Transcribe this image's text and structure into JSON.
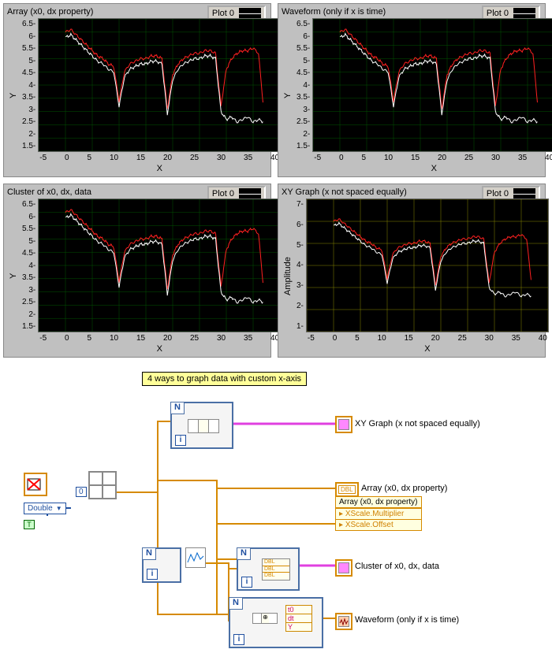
{
  "panels": [
    {
      "title": "Array (x0, dx property)",
      "legend": "Plot 0",
      "ylabel": "Y",
      "xlabel": "X",
      "grid": "green"
    },
    {
      "title": "Waveform (only if x is time)",
      "legend": "Plot 0",
      "ylabel": "Y",
      "xlabel": "X",
      "grid": "green"
    },
    {
      "title": "Cluster of x0, dx, data",
      "legend": "Plot 0",
      "ylabel": "Y",
      "xlabel": "X",
      "grid": "green"
    },
    {
      "title": "XY Graph (x not spaced equally)",
      "legend": "Plot 0",
      "ylabel": "Amplitude",
      "xlabel": "X",
      "grid": "yellow"
    }
  ],
  "chart_data": [
    {
      "type": "line",
      "title": "Array (x0, dx property)",
      "xlabel": "X",
      "ylabel": "Y",
      "xlim": [
        -5,
        40
      ],
      "ylim": [
        1.5,
        6.5
      ],
      "xticks": [
        -5,
        0,
        5,
        10,
        15,
        20,
        25,
        30,
        35,
        40
      ],
      "yticks": [
        1.5,
        2,
        2.5,
        3,
        3.5,
        4,
        4.5,
        5,
        5.5,
        6,
        6.5
      ],
      "grid_color": "#005500",
      "series": [
        {
          "name": "red",
          "x": [
            0,
            1,
            2,
            3,
            4,
            5,
            6,
            7,
            8,
            9,
            10,
            11,
            12,
            13,
            14,
            15,
            16,
            17,
            18,
            19,
            20,
            21,
            22,
            23,
            24,
            25,
            26,
            27,
            28,
            29,
            30,
            31,
            32,
            33,
            34,
            35,
            36,
            37
          ],
          "values": [
            6.0,
            6.1,
            5.9,
            5.7,
            5.5,
            5.3,
            5.1,
            5.0,
            4.8,
            4.7,
            3.4,
            4.5,
            4.8,
            4.9,
            5.0,
            5.0,
            5.1,
            5.1,
            5.0,
            3.1,
            4.4,
            4.8,
            5.0,
            5.1,
            5.2,
            5.2,
            5.3,
            5.3,
            5.2,
            3.2,
            4.6,
            5.0,
            5.2,
            5.3,
            5.3,
            5.4,
            5.2,
            3.0
          ]
        },
        {
          "name": "white",
          "x": [
            0,
            1,
            2,
            3,
            4,
            5,
            6,
            7,
            8,
            9,
            10,
            11,
            12,
            13,
            14,
            15,
            16,
            17,
            18,
            19,
            20,
            21,
            22,
            23,
            24,
            25,
            26,
            27,
            28,
            29,
            30,
            31,
            32,
            33,
            34,
            35,
            36,
            37
          ],
          "values": [
            5.8,
            5.9,
            5.7,
            5.5,
            5.3,
            5.1,
            4.9,
            4.8,
            4.6,
            4.5,
            3.2,
            4.3,
            4.6,
            4.7,
            4.8,
            4.8,
            4.9,
            4.9,
            4.8,
            2.9,
            4.2,
            4.6,
            4.8,
            4.9,
            5.0,
            5.0,
            5.1,
            5.1,
            5.0,
            3.0,
            2.7,
            2.8,
            2.6,
            2.7,
            2.8,
            2.6,
            2.7,
            2.6
          ]
        }
      ]
    },
    {
      "type": "line",
      "title": "Waveform (only if x is time)",
      "xlabel": "X",
      "ylabel": "Y",
      "xlim": [
        -5,
        40
      ],
      "ylim": [
        1.5,
        6.5
      ],
      "xticks": [
        -5,
        0,
        5,
        10,
        15,
        20,
        25,
        30,
        35,
        40
      ],
      "yticks": [
        1.5,
        2,
        2.5,
        3,
        3.5,
        4,
        4.5,
        5,
        5.5,
        6,
        6.5
      ],
      "grid_color": "#005500",
      "series": [
        {
          "name": "red",
          "x": [
            0,
            1,
            2,
            3,
            4,
            5,
            6,
            7,
            8,
            9,
            10,
            11,
            12,
            13,
            14,
            15,
            16,
            17,
            18,
            19,
            20,
            21,
            22,
            23,
            24,
            25,
            26,
            27,
            28,
            29,
            30,
            31,
            32,
            33,
            34,
            35,
            36,
            37
          ],
          "values": [
            6.0,
            6.1,
            5.9,
            5.7,
            5.5,
            5.3,
            5.1,
            5.0,
            4.8,
            4.7,
            3.4,
            4.5,
            4.8,
            4.9,
            5.0,
            5.0,
            5.1,
            5.1,
            5.0,
            3.1,
            4.4,
            4.8,
            5.0,
            5.1,
            5.2,
            5.2,
            5.3,
            5.3,
            5.2,
            3.2,
            4.6,
            5.0,
            5.2,
            5.3,
            5.3,
            5.4,
            5.2,
            3.0
          ]
        },
        {
          "name": "white",
          "x": [
            0,
            1,
            2,
            3,
            4,
            5,
            6,
            7,
            8,
            9,
            10,
            11,
            12,
            13,
            14,
            15,
            16,
            17,
            18,
            19,
            20,
            21,
            22,
            23,
            24,
            25,
            26,
            27,
            28,
            29,
            30,
            31,
            32,
            33,
            34,
            35,
            36,
            37
          ],
          "values": [
            5.8,
            5.9,
            5.7,
            5.5,
            5.3,
            5.1,
            4.9,
            4.8,
            4.6,
            4.5,
            3.2,
            4.3,
            4.6,
            4.7,
            4.8,
            4.8,
            4.9,
            4.9,
            4.8,
            2.9,
            4.2,
            4.6,
            4.8,
            4.9,
            5.0,
            5.0,
            5.1,
            5.1,
            5.0,
            3.0,
            2.7,
            2.8,
            2.6,
            2.7,
            2.8,
            2.6,
            2.7,
            2.6
          ]
        }
      ]
    },
    {
      "type": "line",
      "title": "Cluster of x0, dx, data",
      "xlabel": "X",
      "ylabel": "Y",
      "xlim": [
        -5,
        40
      ],
      "ylim": [
        1.5,
        6.5
      ],
      "xticks": [
        -5,
        0,
        5,
        10,
        15,
        20,
        25,
        30,
        35,
        40
      ],
      "yticks": [
        1.5,
        2,
        2.5,
        3,
        3.5,
        4,
        4.5,
        5,
        5.5,
        6,
        6.5
      ],
      "grid_color": "#005500",
      "series": [
        {
          "name": "red",
          "x": [
            0,
            1,
            2,
            3,
            4,
            5,
            6,
            7,
            8,
            9,
            10,
            11,
            12,
            13,
            14,
            15,
            16,
            17,
            18,
            19,
            20,
            21,
            22,
            23,
            24,
            25,
            26,
            27,
            28,
            29,
            30,
            31,
            32,
            33,
            34,
            35,
            36,
            37
          ],
          "values": [
            6.0,
            6.1,
            5.9,
            5.7,
            5.5,
            5.3,
            5.1,
            5.0,
            4.8,
            4.7,
            3.4,
            4.5,
            4.8,
            4.9,
            5.0,
            5.0,
            5.1,
            5.1,
            5.0,
            3.1,
            4.4,
            4.8,
            5.0,
            5.1,
            5.2,
            5.2,
            5.3,
            5.3,
            5.2,
            3.2,
            4.6,
            5.0,
            5.2,
            5.3,
            5.3,
            5.4,
            5.2,
            3.0
          ]
        },
        {
          "name": "white",
          "x": [
            0,
            1,
            2,
            3,
            4,
            5,
            6,
            7,
            8,
            9,
            10,
            11,
            12,
            13,
            14,
            15,
            16,
            17,
            18,
            19,
            20,
            21,
            22,
            23,
            24,
            25,
            26,
            27,
            28,
            29,
            30,
            31,
            32,
            33,
            34,
            35,
            36,
            37
          ],
          "values": [
            5.8,
            5.9,
            5.7,
            5.5,
            5.3,
            5.1,
            4.9,
            4.8,
            4.6,
            4.5,
            3.2,
            4.3,
            4.6,
            4.7,
            4.8,
            4.8,
            4.9,
            4.9,
            4.8,
            2.9,
            4.2,
            4.6,
            4.8,
            4.9,
            5.0,
            5.0,
            5.1,
            5.1,
            5.0,
            3.0,
            2.7,
            2.8,
            2.6,
            2.7,
            2.8,
            2.6,
            2.7,
            2.6
          ]
        }
      ]
    },
    {
      "type": "line",
      "title": "XY Graph (x not spaced equally)",
      "xlabel": "X",
      "ylabel": "Amplitude",
      "xlim": [
        -5,
        40
      ],
      "ylim": [
        1,
        7
      ],
      "xticks": [
        -5,
        0,
        5,
        10,
        15,
        20,
        25,
        30,
        35,
        40
      ],
      "yticks": [
        1,
        2,
        3,
        4,
        5,
        6,
        7
      ],
      "grid_color": "#888800",
      "series": [
        {
          "name": "red",
          "x": [
            0,
            1,
            2,
            3,
            4,
            5,
            6,
            7,
            8,
            9,
            10,
            11,
            12,
            13,
            14,
            15,
            16,
            17,
            18,
            19,
            20,
            21,
            22,
            23,
            24,
            25,
            26,
            27,
            28,
            29,
            30,
            31,
            32,
            33,
            34,
            35,
            36,
            37
          ],
          "values": [
            6.0,
            6.1,
            5.9,
            5.7,
            5.5,
            5.3,
            5.1,
            5.0,
            4.8,
            4.7,
            3.4,
            4.5,
            4.8,
            4.9,
            5.0,
            5.0,
            5.1,
            5.1,
            5.0,
            3.1,
            4.4,
            4.8,
            5.0,
            5.1,
            5.2,
            5.2,
            5.3,
            5.3,
            5.2,
            3.2,
            4.6,
            5.0,
            5.2,
            5.3,
            5.3,
            5.4,
            5.2,
            3.0
          ]
        },
        {
          "name": "white",
          "x": [
            0,
            1,
            2,
            3,
            4,
            5,
            6,
            7,
            8,
            9,
            10,
            11,
            12,
            13,
            14,
            15,
            16,
            17,
            18,
            19,
            20,
            21,
            22,
            23,
            24,
            25,
            26,
            27,
            28,
            29,
            30,
            31,
            32,
            33,
            34,
            35,
            36,
            37
          ],
          "values": [
            5.8,
            5.9,
            5.7,
            5.5,
            5.3,
            5.1,
            4.9,
            4.8,
            4.6,
            4.5,
            3.2,
            4.3,
            4.6,
            4.7,
            4.8,
            4.8,
            4.9,
            4.9,
            4.8,
            2.9,
            4.2,
            4.6,
            4.8,
            4.9,
            5.0,
            5.0,
            5.1,
            5.1,
            5.0,
            3.0,
            2.7,
            2.8,
            2.6,
            2.7,
            2.8,
            2.6,
            2.7,
            2.6
          ]
        }
      ]
    }
  ],
  "diagram": {
    "title": "4 ways to graph  data with custom x-axis",
    "terminals": {
      "xy": "XY Graph (x not spaced equally)",
      "array": "Array (x0, dx property)",
      "prop_header": "Array (x0, dx property)",
      "prop1": "XScale.Multiplier",
      "prop2": "XScale.Offset",
      "cluster": "Cluster of x0, dx, data",
      "waveform": "Waveform (only if x is time)",
      "datatype": "Double",
      "zero": "0",
      "t0": "t0",
      "dt": "dt",
      "Y": "Y",
      "dbl": "DBL"
    }
  }
}
